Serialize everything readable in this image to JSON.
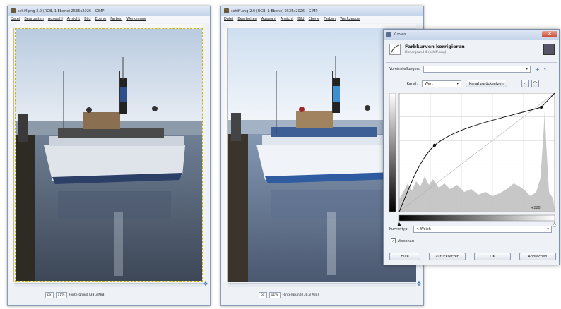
{
  "left_window": {
    "title": "schiff.png-2.0 (RGB, 1 Ebene) 2535x2026 – GIMP",
    "menu": [
      "Datei",
      "Bearbeiten",
      "Auswahl",
      "Ansicht",
      "Bild",
      "Ebene",
      "Farben",
      "Werkzeuge"
    ],
    "unit": "px",
    "zoom": "11%",
    "status": "Hintergrund (33,3 MiB)"
  },
  "right_window": {
    "title": "schiff.png-2.0 (RGB, 1 Ebene) 2535x2026 – GIMP",
    "menu": [
      "Datei",
      "Bearbeiten",
      "Auswahl",
      "Ansicht",
      "Bild",
      "Ebene",
      "Farben",
      "Werkzeuge"
    ],
    "unit": "px",
    "zoom": "11%",
    "status": "Hintergrund (38,8 MiB)"
  },
  "dialog": {
    "title": "Kurven",
    "heading": "Farbkurven korrigieren",
    "subheading": "Hintergrund-4 (schiff.png)",
    "presets_label": "Voreinstellungen:",
    "channel_label": "Kanal:",
    "channel_value": "Wert",
    "reset_channel": "Kanal zurücksetzen",
    "readout": "+228",
    "curve_type_label": "Kurventyp:",
    "curve_type_value": "Weich",
    "preview_label": "Vorschau",
    "buttons": {
      "help": "Hilfe",
      "reset": "Zurücksetzen",
      "ok": "OK",
      "cancel": "Abbrechen"
    }
  },
  "colors": {
    "accent": "#3b6fc0",
    "close": "#c8452c"
  }
}
